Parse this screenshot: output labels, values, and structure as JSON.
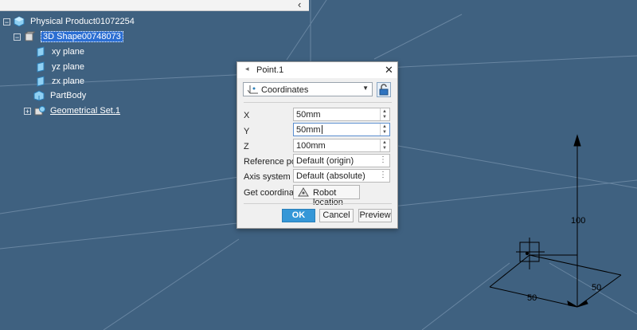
{
  "tree": {
    "root": "Physical Product01072254",
    "shape": "3D Shape00748073",
    "children": [
      "xy plane",
      "yz plane",
      "zx plane",
      "PartBody",
      "Geometrical Set.1"
    ]
  },
  "dialog": {
    "title": "Point.1",
    "point_type": "Coordinates",
    "x_label": "X",
    "x_value": "50mm",
    "y_label": "Y",
    "y_value": "50mm",
    "z_label": "Z",
    "z_value": "100mm",
    "ref_label": "Reference point",
    "ref_value": "Default (origin)",
    "axis_label": "Axis system",
    "axis_value": "Default (absolute)",
    "getcoord_label": "Get coordinates",
    "robot_label": "Robot location",
    "ok": "OK",
    "cancel": "Cancel",
    "preview": "Preview"
  },
  "viewport": {
    "dim_z": "100",
    "dim_x": "50",
    "dim_y": "50"
  },
  "colors": {
    "background": "#3f6180",
    "selection": "#2b6ed2",
    "ok_button": "#3597d7"
  }
}
